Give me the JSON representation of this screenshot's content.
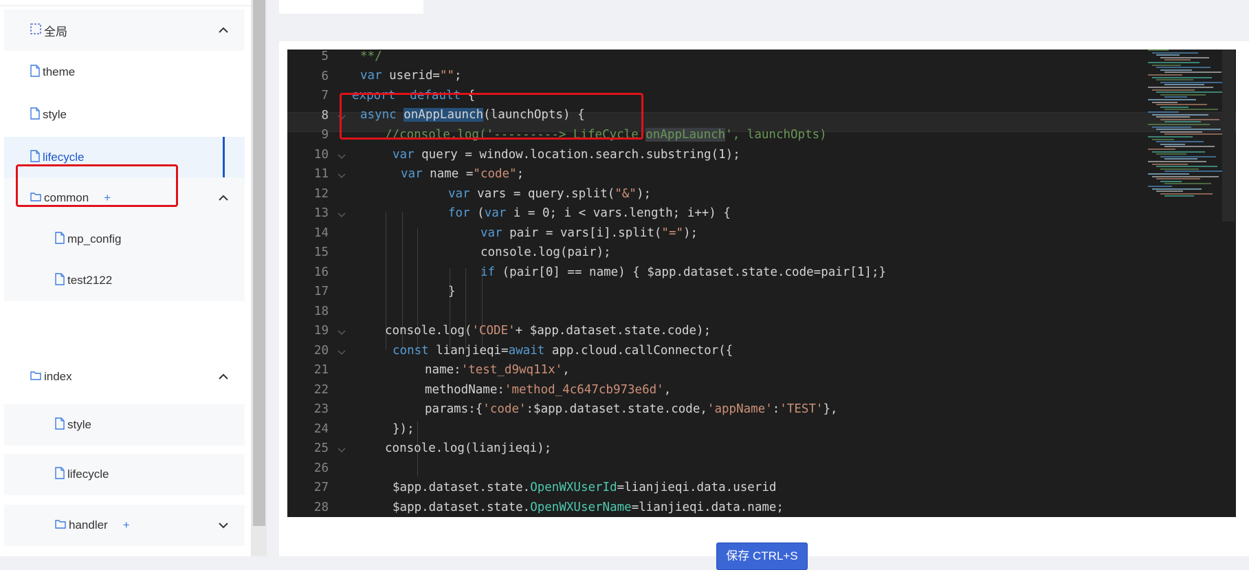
{
  "sidebar": {
    "items": [
      {
        "label": "全局",
        "type": "group",
        "icon": "global-dashed-icon"
      },
      {
        "label": "theme",
        "type": "file",
        "icon": "file-icon"
      },
      {
        "label": "style",
        "type": "file",
        "icon": "file-icon"
      },
      {
        "label": "lifecycle",
        "type": "file",
        "icon": "file-icon",
        "selected": true
      },
      {
        "label": "common",
        "type": "folder",
        "icon": "folder-icon",
        "add": "+"
      },
      {
        "label": "mp_config",
        "type": "file",
        "icon": "file-icon"
      },
      {
        "label": "test2122",
        "type": "file",
        "icon": "file-icon"
      },
      {
        "label": "index",
        "type": "folder",
        "icon": "folder-icon"
      },
      {
        "label": "style",
        "type": "file",
        "icon": "file-icon"
      },
      {
        "label": "lifecycle",
        "type": "file",
        "icon": "file-icon"
      },
      {
        "label": "handler",
        "type": "folder",
        "icon": "folder-icon",
        "add": "+"
      }
    ]
  },
  "editor": {
    "line_numbers": [
      "5",
      "6",
      "7",
      "8",
      "9",
      "10",
      "11",
      "12",
      "13",
      "14",
      "15",
      "16",
      "17",
      "18",
      "19",
      "20",
      "21",
      "22",
      "23",
      "24",
      "25",
      "26",
      "27",
      "28"
    ]
  },
  "colors": {
    "accent": "#1a56c8",
    "highlight_box": "#e0121a",
    "editor_bg": "#1e1e1e",
    "save_button": "#3a66d6"
  },
  "save_button": {
    "label": "保存 CTRL+S"
  }
}
